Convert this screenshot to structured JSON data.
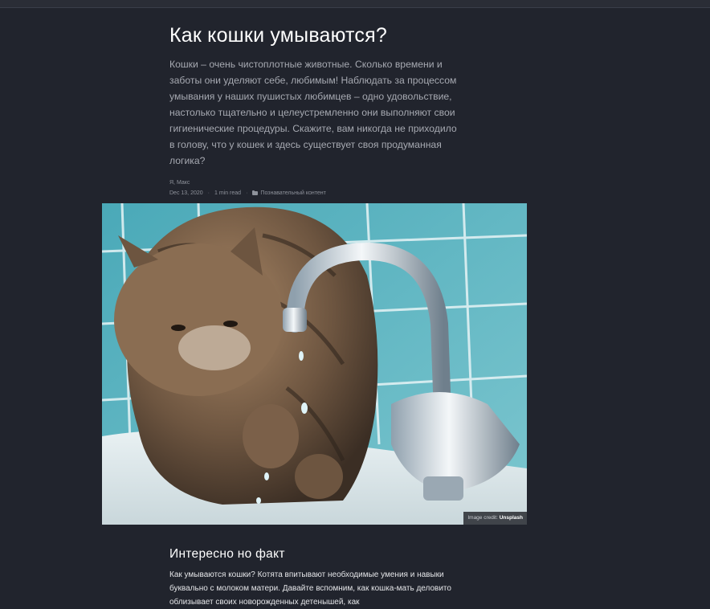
{
  "article": {
    "title": "Как кошки умываются?",
    "intro": "Кошки – очень чистоплотные животные. Сколько времени и заботы они уделяют себе, любимым! Наблюдать за процессом умывания у наших пушистых любимцев – одно удовольствие, настолько тщательно и целеустремленно они выполняют свои гигиенические процедуры. Скажите, вам никогда не приходило в голову, что у кошек и здесь существует своя продуманная логика?",
    "author": "Я, Макс",
    "date": "Dec 13, 2020",
    "separator": "·",
    "read_time": "1 min read",
    "category": "Познавательный контент",
    "category_icon": "folder-icon"
  },
  "image": {
    "credit_prefix": "Image credit:",
    "credit_source": "Unsplash"
  },
  "section": {
    "heading": "Интересно но факт",
    "text": "Как умываются кошки? Котята впитывают необходимые умения и навыки буквально с молоком матери. Давайте вспомним, как кошка-мать деловито облизывает своих новорожденных детенышей, как"
  },
  "colors": {
    "background": "#21242d",
    "title": "#ffffff",
    "muted": "#a6a9b1"
  }
}
